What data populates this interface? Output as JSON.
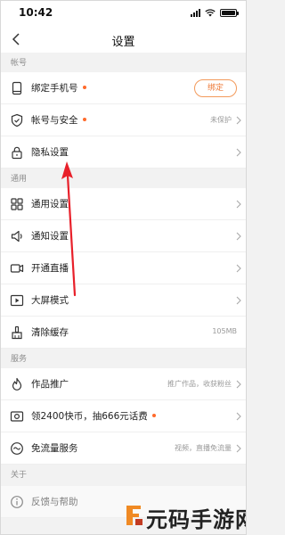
{
  "status_bar": {
    "time": "10:42"
  },
  "nav": {
    "title": "设置"
  },
  "sections": {
    "account": "帐号",
    "general": "通用",
    "services": "服务",
    "about": "关于"
  },
  "rows": {
    "bind_phone": {
      "label": "绑定手机号",
      "button": "绑定"
    },
    "account_security": {
      "label": "帐号与安全",
      "value": "未保护"
    },
    "privacy": {
      "label": "隐私设置"
    },
    "general_settings": {
      "label": "通用设置"
    },
    "notification": {
      "label": "通知设置"
    },
    "live": {
      "label": "开通直播"
    },
    "big_screen": {
      "label": "大屏模式"
    },
    "clear_cache": {
      "label": "清除缓存",
      "value": "105MB"
    },
    "promotion": {
      "label": "作品推广",
      "value": "推广作品，收获粉丝"
    },
    "coins": {
      "label": "领2400快币，抽666元话费"
    },
    "free_data": {
      "label": "免流量服务",
      "value": "视频，直播免流量"
    },
    "feedback": {
      "label": "反馈与帮助"
    }
  },
  "watermark": {
    "text": "元码手游网"
  },
  "colors": {
    "accent": "#ff6a2c",
    "annotation_arrow": "#e8202a",
    "background": "#f2f2f2"
  },
  "icons": [
    "back-icon",
    "phone-icon",
    "shield-icon",
    "lock-icon",
    "grid-icon",
    "speaker-icon",
    "camera-icon",
    "play-icon",
    "broom-icon",
    "flame-icon",
    "coin-card-icon",
    "wave-icon",
    "feedback-icon",
    "chevron-right-icon"
  ]
}
